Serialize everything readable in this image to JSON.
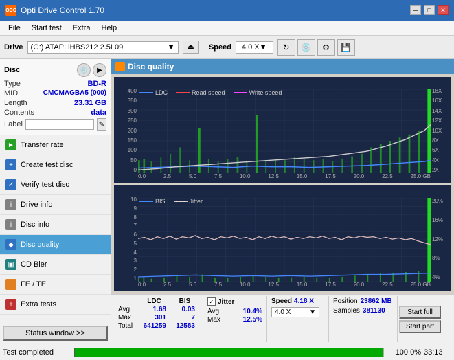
{
  "titlebar": {
    "title": "Opti Drive Control 1.70",
    "icon": "ODC",
    "minimize": "─",
    "maximize": "□",
    "close": "✕"
  },
  "menubar": {
    "items": [
      "File",
      "Start test",
      "Extra",
      "Help"
    ]
  },
  "drivebar": {
    "label": "Drive",
    "drive_value": "(G:)  ATAPI iHBS212  2.5L09",
    "speed_label": "Speed",
    "speed_value": "4.0 X"
  },
  "disc": {
    "title": "Disc",
    "type_label": "Type",
    "type_value": "BD-R",
    "mid_label": "MID",
    "mid_value": "CMCMAGBA5 (000)",
    "length_label": "Length",
    "length_value": "23.31 GB",
    "contents_label": "Contents",
    "contents_value": "data",
    "label_label": "Label",
    "label_value": ""
  },
  "nav": {
    "items": [
      {
        "id": "transfer-rate",
        "label": "Transfer rate",
        "icon": "►",
        "iconClass": "green"
      },
      {
        "id": "create-test",
        "label": "Create test disc",
        "icon": "+",
        "iconClass": "blue"
      },
      {
        "id": "verify-test",
        "label": "Verify test disc",
        "icon": "✓",
        "iconClass": "blue"
      },
      {
        "id": "drive-info",
        "label": "Drive info",
        "icon": "i",
        "iconClass": "gray"
      },
      {
        "id": "disc-info",
        "label": "Disc info",
        "icon": "i",
        "iconClass": "gray"
      },
      {
        "id": "disc-quality",
        "label": "Disc quality",
        "icon": "◆",
        "iconClass": "blue",
        "active": true
      },
      {
        "id": "cd-bier",
        "label": "CD Bier",
        "icon": "▣",
        "iconClass": "teal"
      },
      {
        "id": "fe-te",
        "label": "FE / TE",
        "icon": "~",
        "iconClass": "orange"
      },
      {
        "id": "extra-tests",
        "label": "Extra tests",
        "icon": "+",
        "iconClass": "red"
      }
    ],
    "status_btn": "Status window >>"
  },
  "chart": {
    "title": "Disc quality",
    "legend1": {
      "ldc": "LDC",
      "read": "Read speed",
      "write": "Write speed"
    },
    "legend2": {
      "bis": "BIS",
      "jitter": "Jitter"
    },
    "top_y_left": [
      "400",
      "350",
      "300",
      "250",
      "200",
      "150",
      "100",
      "50",
      "0"
    ],
    "top_y_right": [
      "18X",
      "16X",
      "14X",
      "12X",
      "10X",
      "8X",
      "6X",
      "4X",
      "2X"
    ],
    "x_labels": [
      "0.0",
      "2.5",
      "5.0",
      "7.5",
      "10.0",
      "12.5",
      "15.0",
      "17.5",
      "20.0",
      "22.5",
      "25.0 GB"
    ],
    "bot_y_left": [
      "10",
      "9",
      "8",
      "7",
      "6",
      "5",
      "4",
      "3",
      "2",
      "1"
    ],
    "bot_y_right": [
      "20%",
      "16%",
      "12%",
      "8%",
      "4%"
    ]
  },
  "stats": {
    "ldc_header": "LDC",
    "bis_header": "BIS",
    "jitter_label": "Jitter",
    "speed_label": "Speed",
    "position_label": "Position",
    "samples_label": "Samples",
    "rows": [
      {
        "label": "Avg",
        "ldc": "1.68",
        "bis": "0.03",
        "jitter": "10.4%"
      },
      {
        "label": "Max",
        "ldc": "301",
        "bis": "7",
        "jitter": "12.5%"
      },
      {
        "label": "Total",
        "ldc": "641259",
        "bis": "12583",
        "jitter": ""
      }
    ],
    "speed_value": "4.18 X",
    "speed_dropdown": "4.0 X",
    "position_value": "23862 MB",
    "samples_value": "381130",
    "jitter_checked": true,
    "start_full_label": "Start full",
    "start_part_label": "Start part"
  },
  "statusbar": {
    "status_text": "Test completed",
    "progress": 100,
    "progress_text": "100.0%",
    "time_text": "33:13"
  }
}
